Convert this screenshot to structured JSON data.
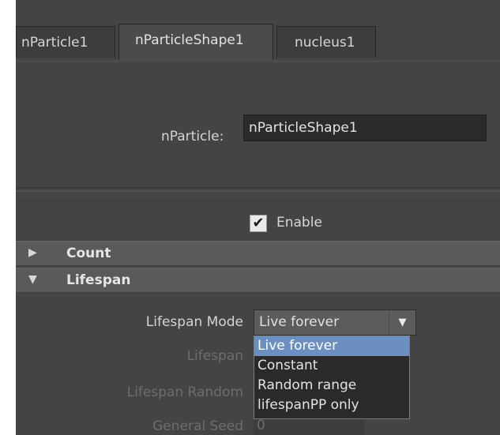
{
  "tabs": [
    {
      "label": "nParticle1",
      "active": false
    },
    {
      "label": "nParticleShape1",
      "active": true
    },
    {
      "label": "nucleus1",
      "active": false
    }
  ],
  "node": {
    "label": "nParticle:",
    "value": "nParticleShape1"
  },
  "enable": {
    "label": "Enable",
    "checked": true,
    "check_glyph": "✔"
  },
  "sections": {
    "count": {
      "title": "Count",
      "expanded": false,
      "arrow": "▶"
    },
    "lifespan": {
      "title": "Lifespan",
      "expanded": true,
      "arrow": "▼"
    }
  },
  "lifespan_fields": {
    "mode_label": "Lifespan Mode",
    "mode_value": "Live forever",
    "chevron": "▼",
    "lifespan_label": "Lifespan",
    "random_label": "Lifespan Random",
    "seed_label": "General Seed",
    "seed_value": "0"
  },
  "dropdown": {
    "options": [
      "Live forever",
      "Constant",
      "Random range",
      "lifespanPP only"
    ],
    "selected_index": 0
  },
  "colors": {
    "panel_bg": "#444444",
    "section_bg": "#5a5a5a",
    "field_bg": "#2b2b2b",
    "highlight": "#6b8fc0"
  }
}
